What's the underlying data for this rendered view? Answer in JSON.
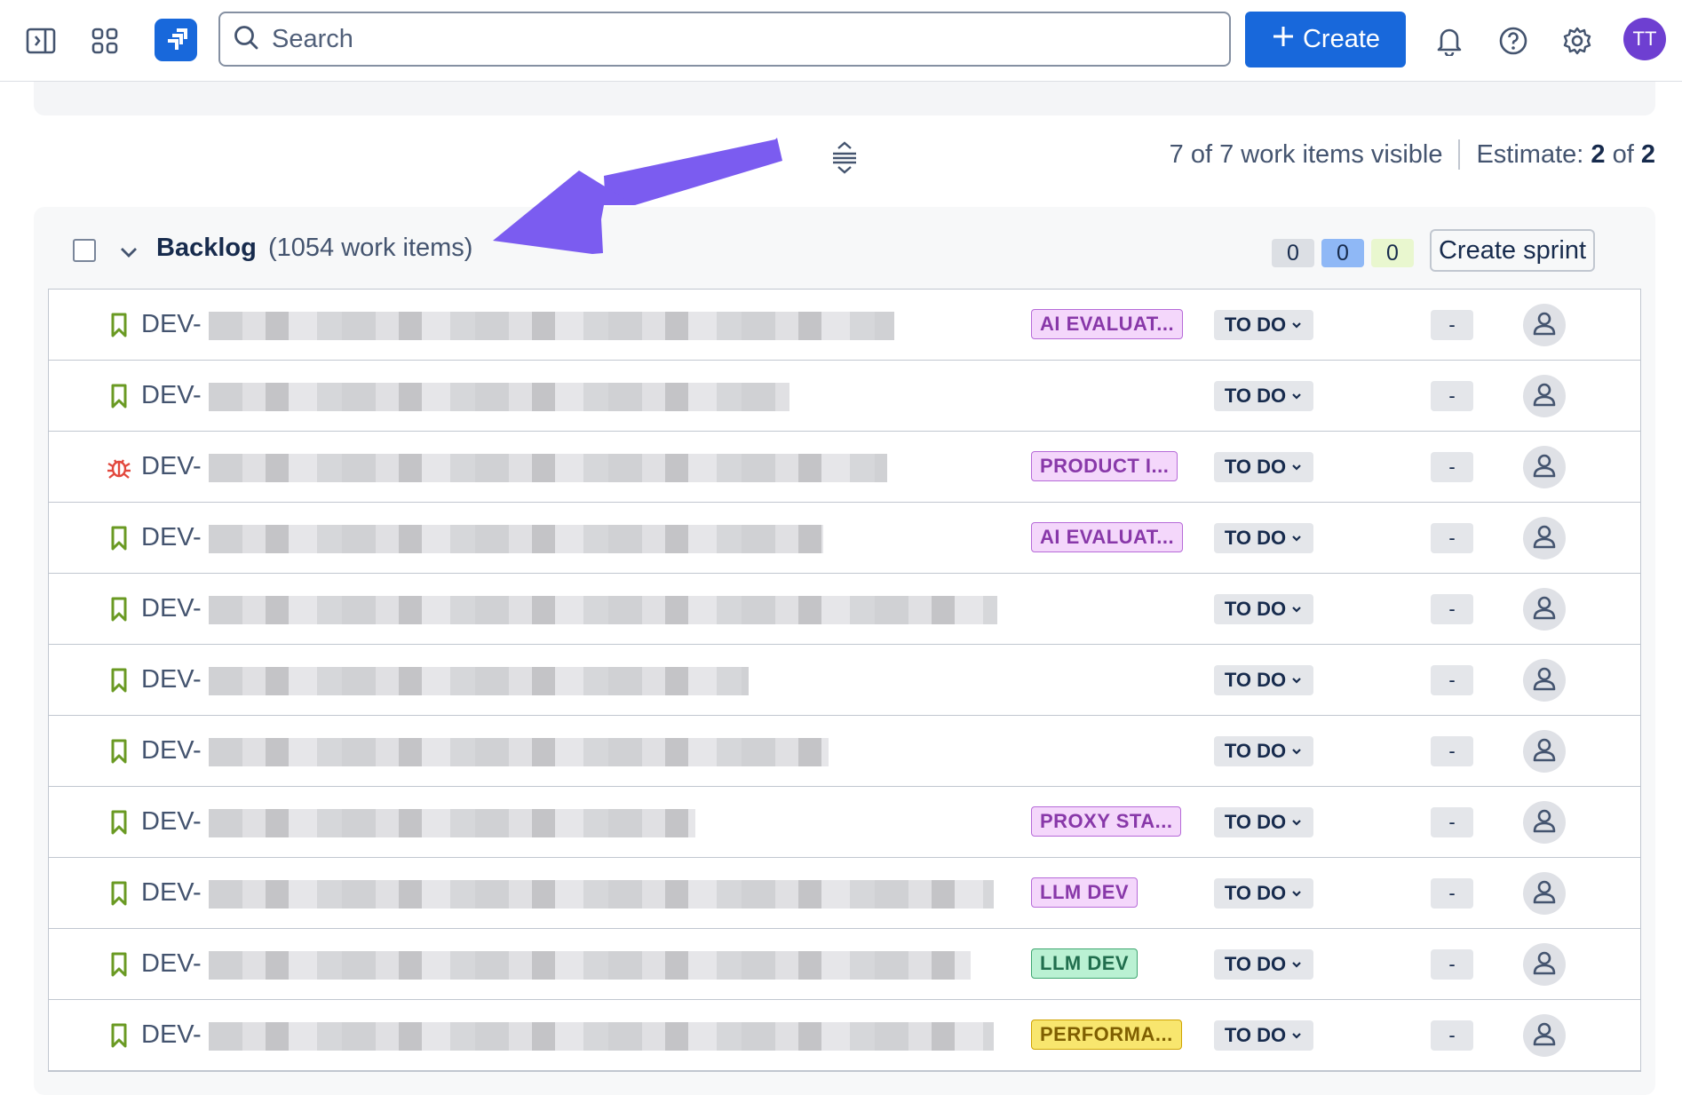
{
  "nav": {
    "search_placeholder": "Search",
    "create_label": "Create",
    "user_initials": "TT"
  },
  "summary": {
    "visible_text": "7 of 7 work items visible",
    "estimate_label": "Estimate:",
    "estimate_done": "2",
    "estimate_of": "of",
    "estimate_total": "2"
  },
  "backlog": {
    "title": "Backlog",
    "count_text": "(1054 work items)",
    "counters": [
      "0",
      "0",
      "0"
    ],
    "create_sprint_label": "Create sprint"
  },
  "colors": {
    "brand": "#1868db",
    "arrow": "#7b5cf0",
    "story_icon": "#6a9a23",
    "bug_icon": "#e2483d"
  },
  "rows": [
    {
      "type": "story-icon",
      "key": "DEV-",
      "epic": "AI EVALUAT...",
      "epic_style": "purple",
      "status": "TO DO",
      "estimate": "-"
    },
    {
      "type": "story-icon",
      "key": "DEV-",
      "epic": "",
      "epic_style": "",
      "status": "TO DO",
      "estimate": "-"
    },
    {
      "type": "bug-icon",
      "key": "DEV-",
      "epic": "PRODUCT I...",
      "epic_style": "purple",
      "status": "TO DO",
      "estimate": "-"
    },
    {
      "type": "story-icon",
      "key": "DEV-",
      "epic": "AI EVALUAT...",
      "epic_style": "purple",
      "status": "TO DO",
      "estimate": "-"
    },
    {
      "type": "story-icon",
      "key": "DEV-",
      "epic": "",
      "epic_style": "",
      "status": "TO DO",
      "estimate": "-"
    },
    {
      "type": "story-icon",
      "key": "DEV-",
      "epic": "",
      "epic_style": "",
      "status": "TO DO",
      "estimate": "-"
    },
    {
      "type": "story-icon",
      "key": "DEV-",
      "epic": "",
      "epic_style": "",
      "status": "TO DO",
      "estimate": "-"
    },
    {
      "type": "story-icon",
      "key": "DEV-",
      "epic": "PROXY STA...",
      "epic_style": "purple",
      "status": "TO DO",
      "estimate": "-"
    },
    {
      "type": "story-icon",
      "key": "DEV-",
      "epic": "LLM DEV",
      "epic_style": "purple",
      "status": "TO DO",
      "estimate": "-"
    },
    {
      "type": "story-icon",
      "key": "DEV-",
      "epic": "LLM DEV",
      "epic_style": "green",
      "status": "TO DO",
      "estimate": "-"
    },
    {
      "type": "story-icon",
      "key": "DEV-",
      "epic": "PERFORMA...",
      "epic_style": "yellow",
      "status": "TO DO",
      "estimate": "-"
    }
  ]
}
